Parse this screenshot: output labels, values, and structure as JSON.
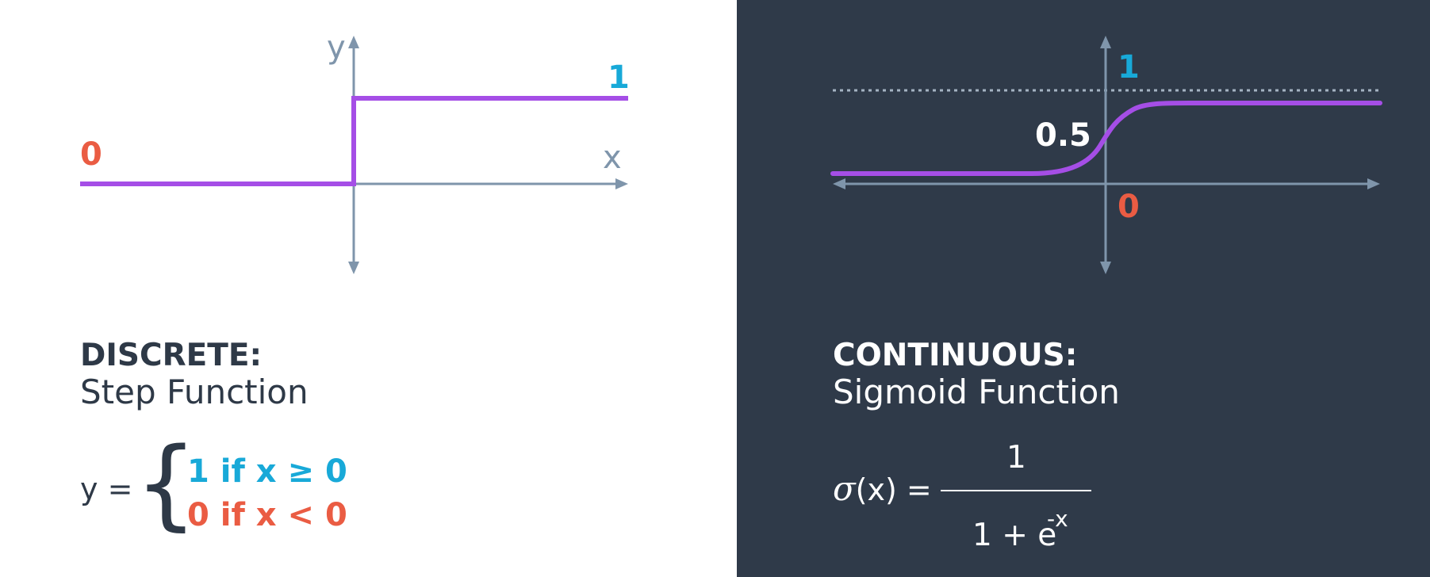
{
  "colors": {
    "left_background": "#ffffff",
    "right_background": "#2f3a49",
    "axis": "#7f95ab",
    "curve": "#a54ee6",
    "blue": "#18a9d8",
    "orange": "#ea5c43",
    "dark_text": "#2e3947",
    "light_text": "#ffffff",
    "dotted_line": "#a5b3c2"
  },
  "left_panel": {
    "graph": {
      "y_axis_label": "y",
      "x_axis_label": "x",
      "left_value_label": "0",
      "right_value_label": "1"
    },
    "heading": "DISCRETE:",
    "subheading": "Step Function",
    "formula": {
      "lhs": "y =",
      "brace": "{",
      "case_one": "1 if x  ≥ 0",
      "case_two": "0 if x < 0"
    }
  },
  "right_panel": {
    "graph": {
      "top_value_label": "1",
      "midpoint_label": "0.5",
      "origin_value_label": "0"
    },
    "heading": "CONTINUOUS:",
    "subheading": "Sigmoid Function",
    "formula": {
      "symbol": "σ",
      "argument": "(x) =",
      "numerator": "1",
      "denominator": "1 + e",
      "exponent": "-x"
    }
  }
}
